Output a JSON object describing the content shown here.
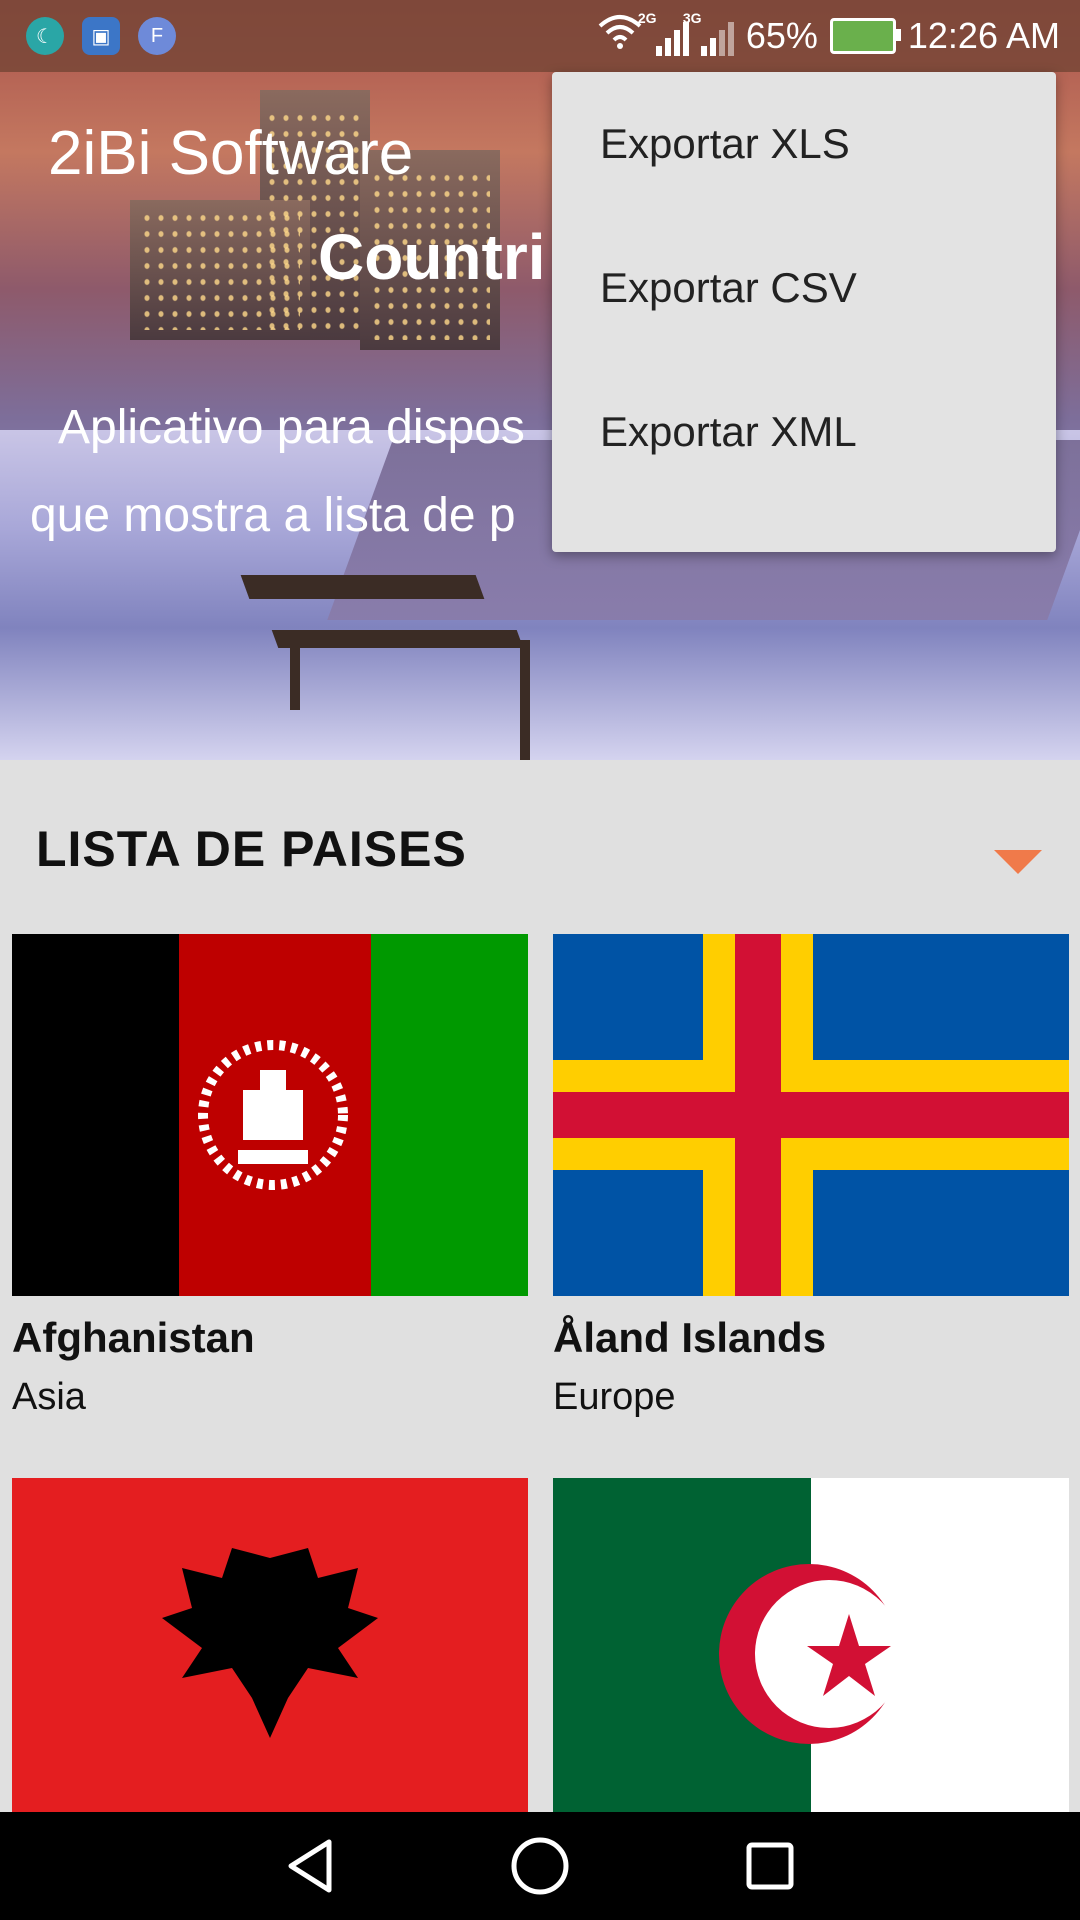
{
  "status_bar": {
    "battery": "65%",
    "time": "12:26 AM",
    "net1": "2G",
    "net2": "3G",
    "notif_icons": [
      "moon-icon",
      "image-icon",
      "f-app-icon"
    ],
    "f_label": "F"
  },
  "hero": {
    "title": "2iBi Software",
    "subtitle": "Countri",
    "desc_line1": "Aplicativo para dispos",
    "desc_line2": "que mostra a lista de p"
  },
  "menu": {
    "items": [
      {
        "label": "Exportar XLS"
      },
      {
        "label": "Exportar CSV"
      },
      {
        "label": "Exportar XML"
      }
    ]
  },
  "section": {
    "title": "LISTA DE PAISES",
    "accent_color": "#f07a4a"
  },
  "countries": [
    {
      "name": "Afghanistan",
      "region": "Asia"
    },
    {
      "name": "Åland Islands",
      "region": "Europe"
    },
    {
      "name": "",
      "region": ""
    },
    {
      "name": "",
      "region": ""
    }
  ],
  "navbar": {
    "buttons": [
      "back-icon",
      "home-icon",
      "recents-icon"
    ]
  }
}
